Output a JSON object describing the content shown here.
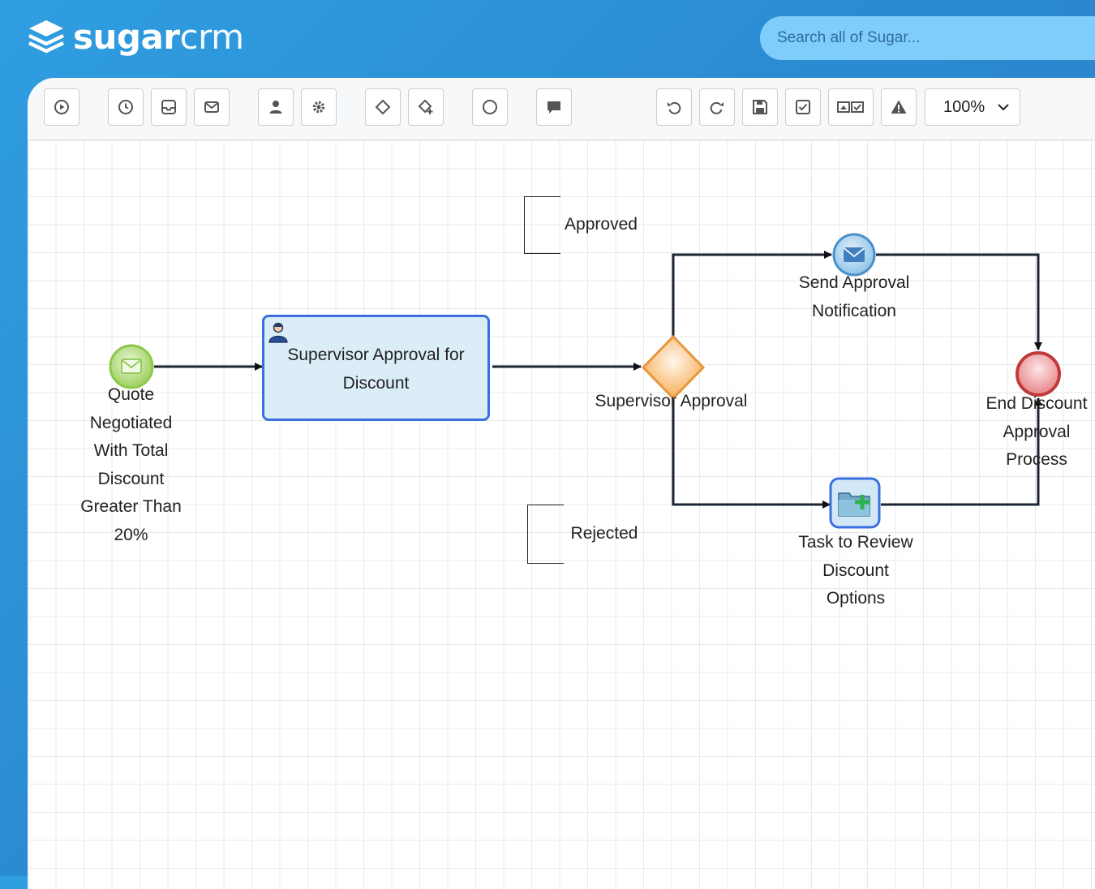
{
  "brand": {
    "logo_bold": "sugar",
    "logo_light": "crm"
  },
  "search": {
    "placeholder": "Search all of Sugar..."
  },
  "toolbar": {
    "zoom_value": "100%"
  },
  "diagram": {
    "start_event": "Quote Negotiated With Total Discount Greater Than 20%",
    "start_event_lines": [
      "Quote",
      "Negotiated",
      "With Total",
      "Discount",
      "Greater Than",
      "20%"
    ],
    "user_task": "Supervisor Approval for Discount",
    "user_task_lines": [
      "Supervisor Approval for",
      "Discount"
    ],
    "gateway": "Supervisor Approval",
    "send_event_lines": [
      "Send Approval",
      "Notification"
    ],
    "review_task_lines": [
      "Task to Review",
      "Discount",
      "Options"
    ],
    "end_event_lines": [
      "End Discount",
      "Approval",
      "Process"
    ],
    "annotation_approved": "Approved",
    "annotation_rejected": "Rejected"
  },
  "colors": {
    "header_blue": "#2f9ee0",
    "task_fill": "#dbedf7",
    "task_border": "#3a6fe0",
    "start_event": "#8cc84b",
    "gateway": "#f29b30",
    "end_event": "#c0393b",
    "message_event": "#4a90c8"
  },
  "icons": {
    "logo": "sugarcrm-stack-icon",
    "toolbar": [
      "play-icon",
      "clock-icon",
      "inbox-icon",
      "envelope-icon",
      "user-icon",
      "gear-icon",
      "diamond-icon",
      "diamond-add-icon",
      "circle-icon",
      "comment-icon",
      "undo-icon",
      "redo-icon",
      "save-icon",
      "validate-icon",
      "toggle-icon",
      "warning-icon"
    ]
  }
}
